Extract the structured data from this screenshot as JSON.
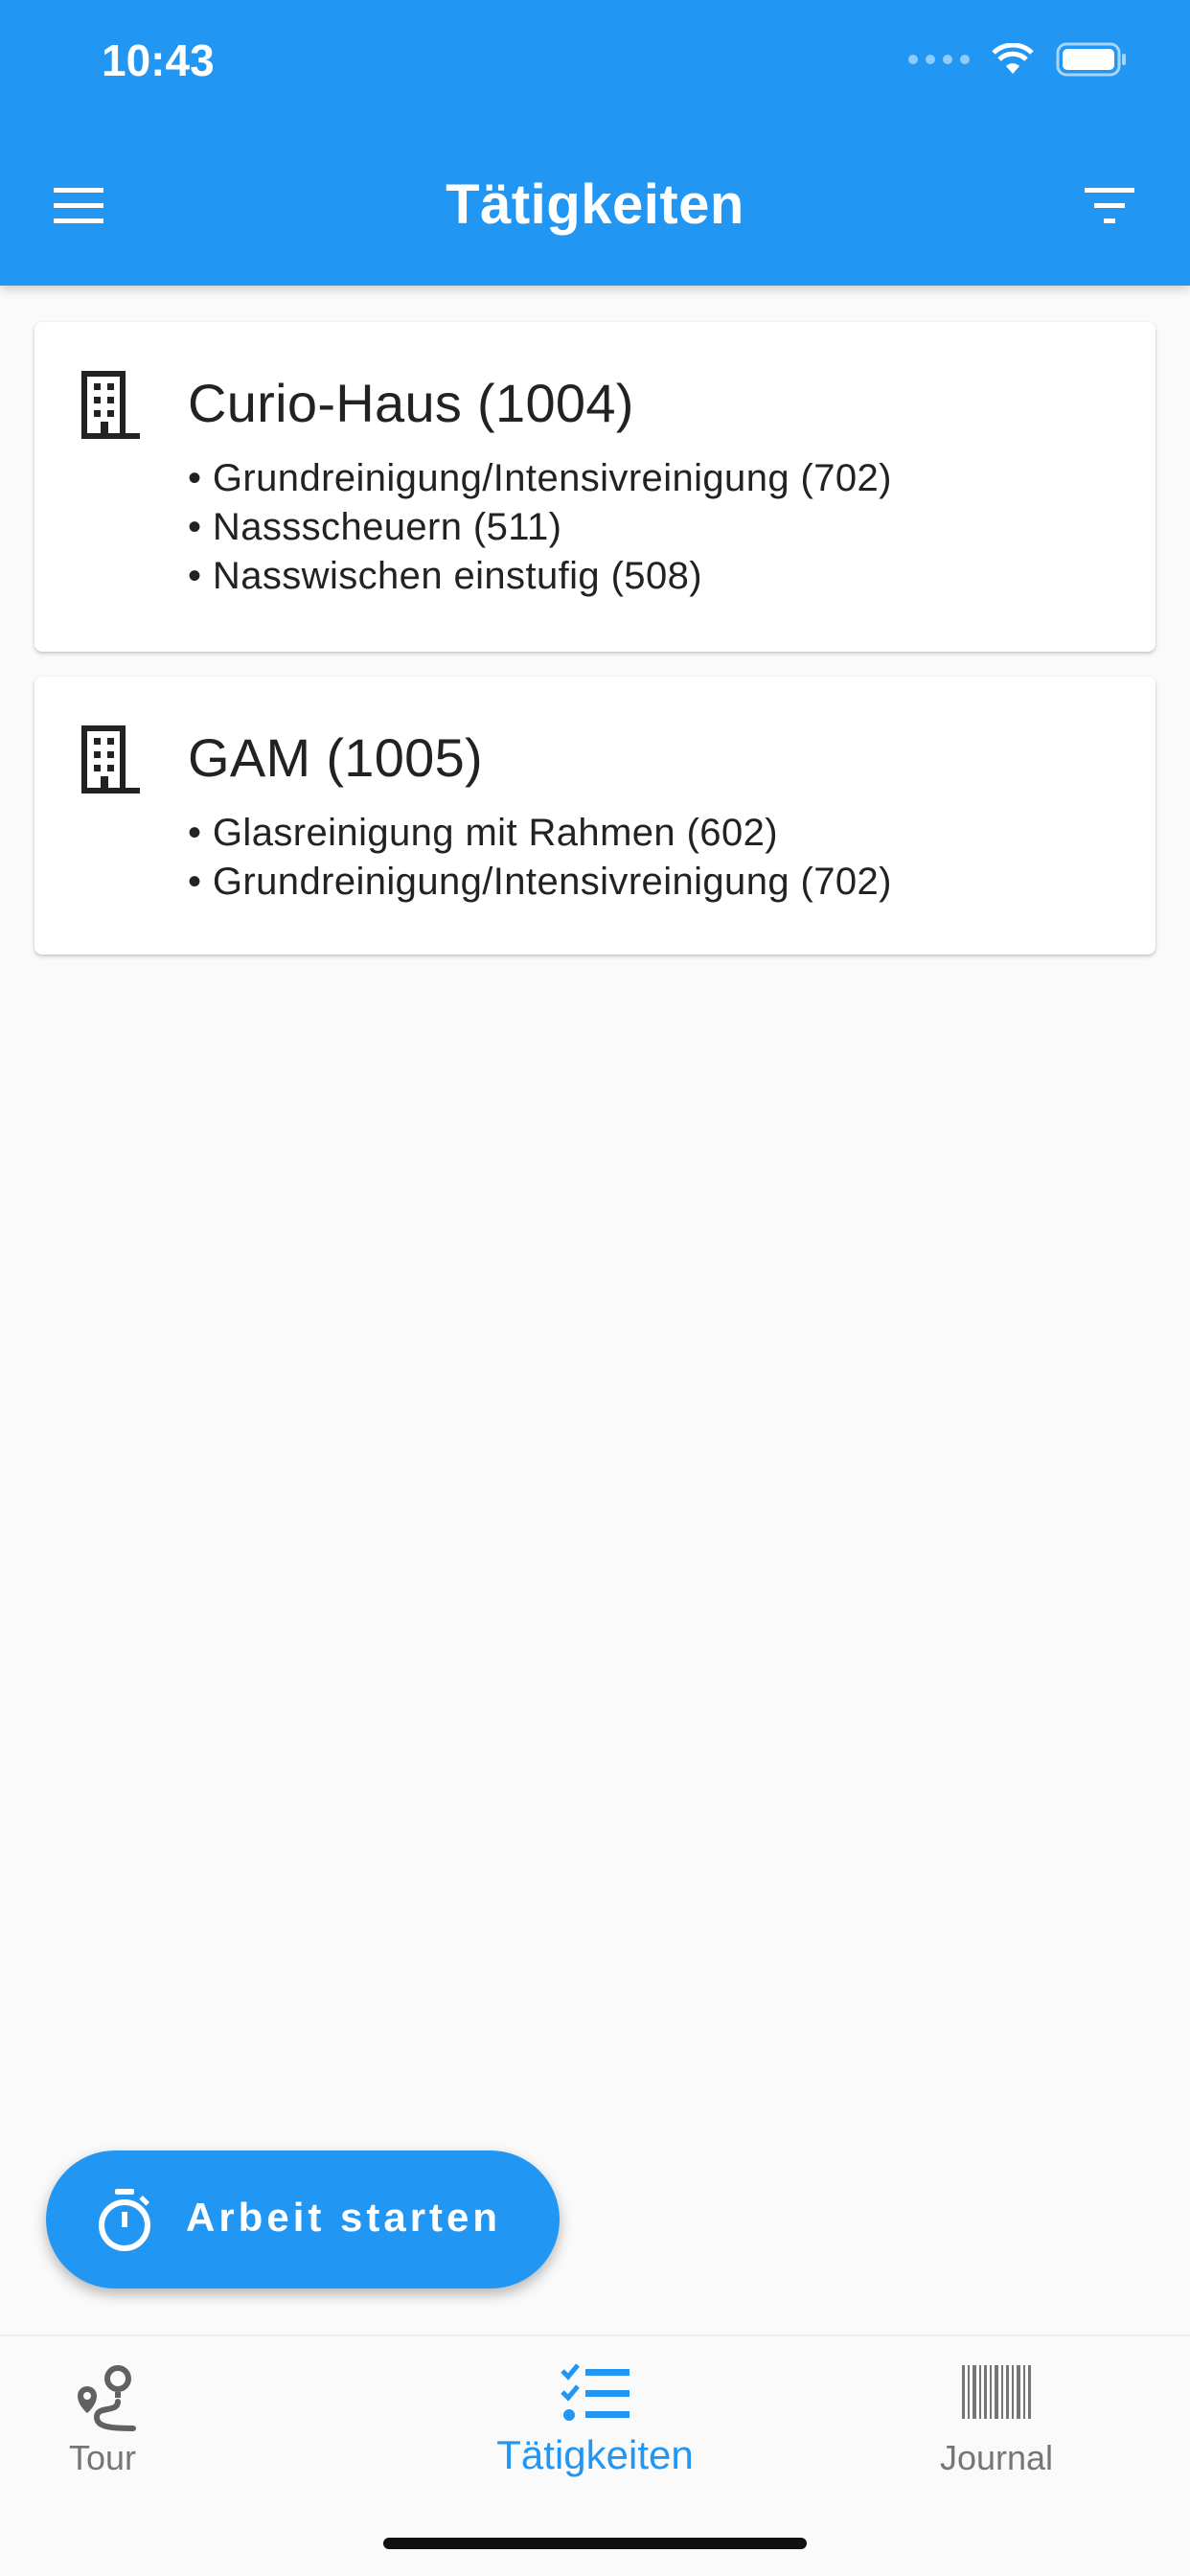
{
  "status_bar": {
    "time": "10:43"
  },
  "app_bar": {
    "title": "Tätigkeiten",
    "menu_icon": "menu-icon",
    "filter_icon": "filter-icon"
  },
  "locations": [
    {
      "title": "Curio-Haus (1004)",
      "icon": "building-icon",
      "tasks": [
        "Grundreinigung/Intensivreinigung (702)",
        "Nassscheuern (511)",
        "Nasswischen einstufig (508)"
      ]
    },
    {
      "title": "GAM (1005)",
      "icon": "building-icon",
      "tasks": [
        "Glasreinigung mit Rahmen (602)",
        "Grundreinigung/Intensivreinigung (702)"
      ]
    }
  ],
  "fab": {
    "label": "Arbeit starten",
    "icon": "timer-icon"
  },
  "bottom_nav": {
    "items": [
      {
        "label": "Tour",
        "icon": "route-icon",
        "active": false
      },
      {
        "label": "Tätigkeiten",
        "icon": "checklist-icon",
        "active": true
      },
      {
        "label": "Journal",
        "icon": "barcode-icon",
        "active": false
      }
    ]
  },
  "colors": {
    "primary": "#2196F3",
    "background": "#fafafa",
    "inactive": "#757575"
  }
}
